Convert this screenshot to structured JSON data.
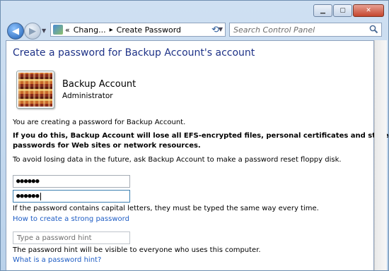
{
  "nav": {
    "breadcrumb_overflow": "«",
    "breadcrumb_parent": "Chang...",
    "breadcrumb_current": "Create Password",
    "search_placeholder": "Search Control Panel"
  },
  "page": {
    "heading": "Create a password for Backup Account's account",
    "account_name": "Backup Account",
    "account_type": "Administrator",
    "intro": "You are creating a password for Backup Account.",
    "warning_line1": "If you do this, Backup Account will lose all EFS-encrypted files, personal certificates and stored",
    "warning_line2": "passwords for Web sites or network resources.",
    "advice": "To avoid losing data in the future, ask Backup Account to make a password reset floppy disk.",
    "password_mask": "●●●●●●",
    "confirm_mask": "●●●●●●",
    "caps_note": "If the password contains capital letters, they must be typed the same way every time.",
    "strong_password_link": "How to create a strong password",
    "hint_placeholder": "Type a password hint",
    "hint_note": "The password hint will be visible to everyone who uses this computer.",
    "hint_link": "What is a password hint?"
  },
  "colors": {
    "heading": "#1e3287",
    "link": "#1d5cc4",
    "chrome": "#b9d1ea"
  }
}
